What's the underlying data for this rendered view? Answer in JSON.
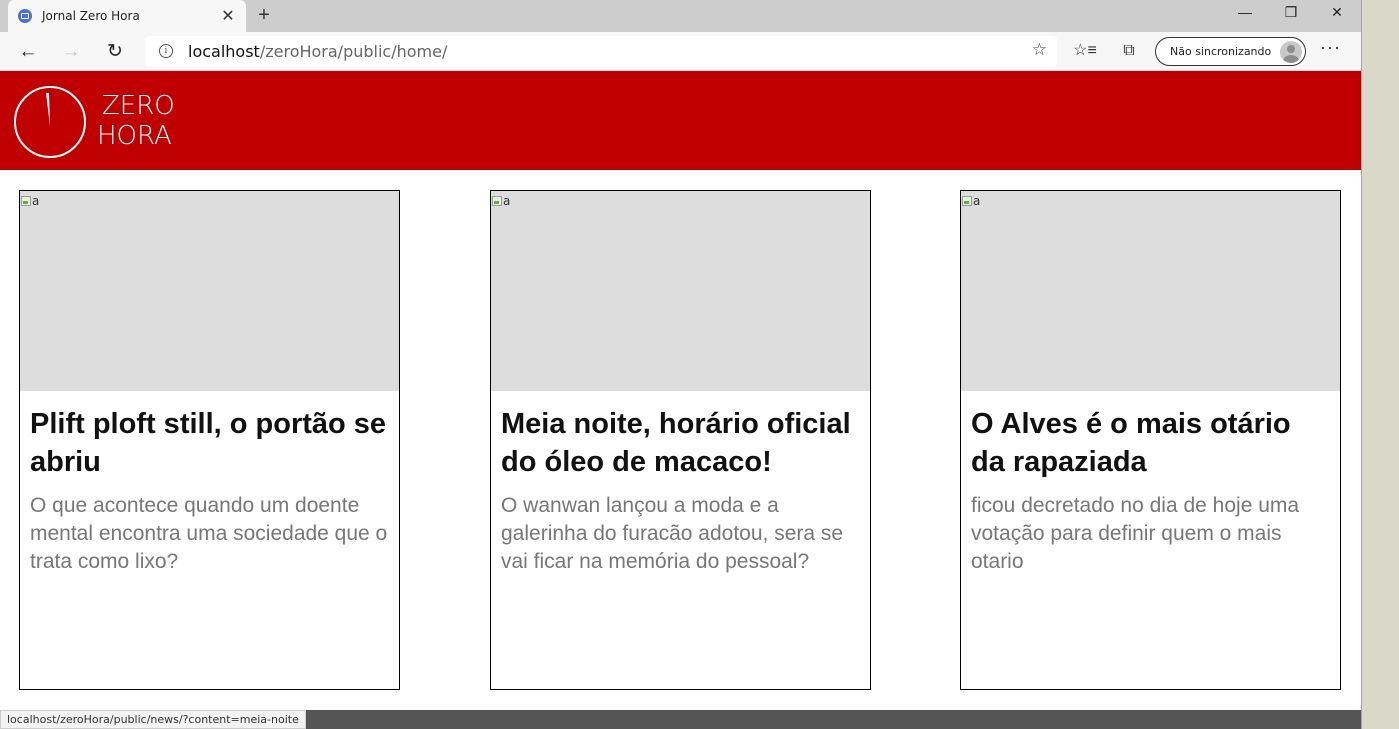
{
  "browser": {
    "tab_title": "Jornal Zero Hora",
    "tab_close": "✕",
    "new_tab": "+",
    "minimize": "—",
    "maximize": "❐",
    "close": "✕",
    "url_host": "localhost",
    "url_path": "/zeroHora/public/home/",
    "profile_label": "Não sincronizando",
    "status_url": "localhost/zeroHora/public/news/?content=meia-noite"
  },
  "site": {
    "logo_line1": "ZERO",
    "logo_line2": "HORA",
    "brand_color": "#c00000"
  },
  "news": [
    {
      "img_alt": "a",
      "title": "Plift ploft still, o portão se abriu",
      "description": "O que acontece quando um doente mental encontra uma sociedade que o trata como lixo?"
    },
    {
      "img_alt": "a",
      "title": "Meia noite, horário oficial do óleo de macaco!",
      "description": "O wanwan lançou a moda e a galerinha do furacão adotou, sera se vai ficar na memória do pessoal?"
    },
    {
      "img_alt": "a",
      "title": "O Alves é o mais otário da rapaziada",
      "description": "ficou decretado no dia de hoje uma votação para definir quem o mais otario"
    }
  ]
}
